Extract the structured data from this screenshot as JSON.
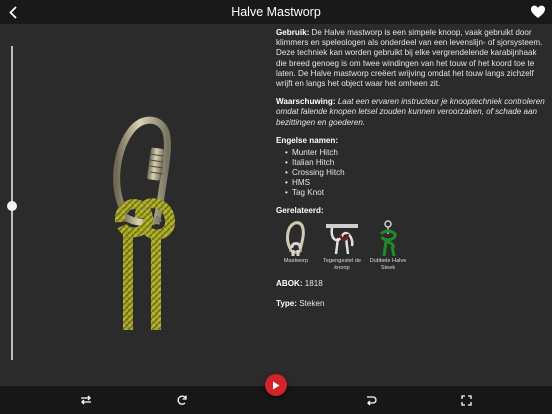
{
  "header": {
    "title": "Halve Mastworp",
    "back_icon": "chevron-left-icon",
    "favorite_icon": "heart-icon"
  },
  "slider": {
    "value": 0.49
  },
  "description": {
    "usage_label": "Gebruik:",
    "usage_text": " De Halve mastworp is een simpele knoop, vaak gebruikt door klimmers en speleologen als onderdeel van een levenslijn- of sjorsysteem. Deze techniek kan worden gebruikt bij elke vergrendelende karabijnhaak die breed genoeg is om twee windingen van het touw of het koord toe te laten. De Halve mastworp creëert wrijving omdat het touw langs zichzelf wrijft en langs het object waar het omheen zit.",
    "warning_label": "Waarschuwing:",
    "warning_text": " Laat een ervaren instructeur je knooptechniek controleren omdat falende knopen letsel zouden kunnen veroorzaken, of schade aan bezittingen en goederen.",
    "english_names_title": "Engelse namen:",
    "english_names": [
      "Munter Hitch",
      "Italian Hitch",
      "Crossing Hitch",
      "HMS",
      "Tag Knot"
    ],
    "related_title": "Gerelateerd:",
    "related": [
      {
        "label": "Mastworp"
      },
      {
        "label": "Tegengestel de knoop"
      },
      {
        "label": "Dubbele Halve Steek"
      }
    ],
    "abok_label": "ABOK:",
    "abok_value": " 1818",
    "type_label": "Type:",
    "type_value": " Steken"
  },
  "toolbar": {
    "icons": [
      "swap-icon",
      "rotate-icon",
      "play-icon",
      "loop-icon",
      "fullscreen-icon"
    ]
  },
  "colors": {
    "play": "#d1232a",
    "rope": "#b5b52a",
    "header": "#191919",
    "background": "#2b2b2b"
  }
}
